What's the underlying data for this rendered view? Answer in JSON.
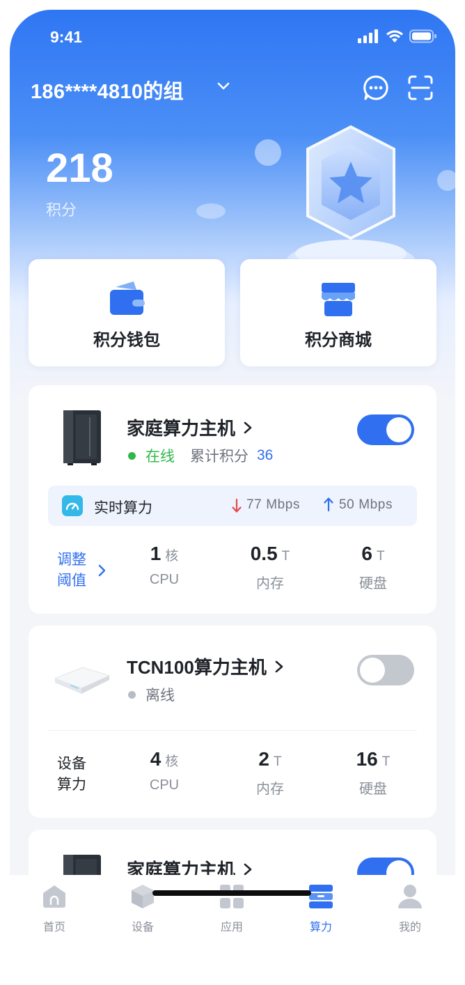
{
  "status_bar": {
    "time": "9:41"
  },
  "header": {
    "group_title": "186****4810的组"
  },
  "points": {
    "value": "218",
    "label": "积分"
  },
  "quick_actions": [
    {
      "label": "积分钱包",
      "icon": "wallet-icon"
    },
    {
      "label": "积分商城",
      "icon": "store-icon"
    }
  ],
  "devices": [
    {
      "name": "家庭算力主机",
      "status": "在线",
      "status_color": "#2fb94a",
      "points_label": "累计积分",
      "points_value": "36",
      "enabled": true,
      "realtime": {
        "label": "实时算力",
        "down": "77 Mbps",
        "up": "50 Mbps"
      },
      "side_label_1": "调整",
      "side_label_2": "阈值",
      "metrics": [
        {
          "value": "1",
          "unit": "核",
          "key": "CPU"
        },
        {
          "value": "0.5",
          "unit": "T",
          "key": "内存"
        },
        {
          "value": "6",
          "unit": "T",
          "key": "硬盘"
        }
      ]
    },
    {
      "name": "TCN100算力主机",
      "status": "离线",
      "status_color": "#b8bcc4",
      "enabled": false,
      "side_label_1": "设备",
      "side_label_2": "算力",
      "metrics": [
        {
          "value": "4",
          "unit": "核",
          "key": "CPU"
        },
        {
          "value": "2",
          "unit": "T",
          "key": "内存"
        },
        {
          "value": "16",
          "unit": "T",
          "key": "硬盘"
        }
      ]
    },
    {
      "name": "家庭算力主机",
      "enabled": true
    }
  ],
  "tabbar": [
    {
      "label": "首页",
      "icon": "home-icon",
      "active": false
    },
    {
      "label": "设备",
      "icon": "device-cube-icon",
      "active": false
    },
    {
      "label": "应用",
      "icon": "apps-grid-icon",
      "active": false
    },
    {
      "label": "算力",
      "icon": "computing-power-icon",
      "active": true
    },
    {
      "label": "我的",
      "icon": "profile-icon",
      "active": false
    }
  ],
  "colors": {
    "primary": "#2f6ff0",
    "online": "#2fb94a",
    "offline": "#b8bcc4",
    "down_arrow": "#e5484d",
    "up_arrow": "#2f6ff0"
  }
}
